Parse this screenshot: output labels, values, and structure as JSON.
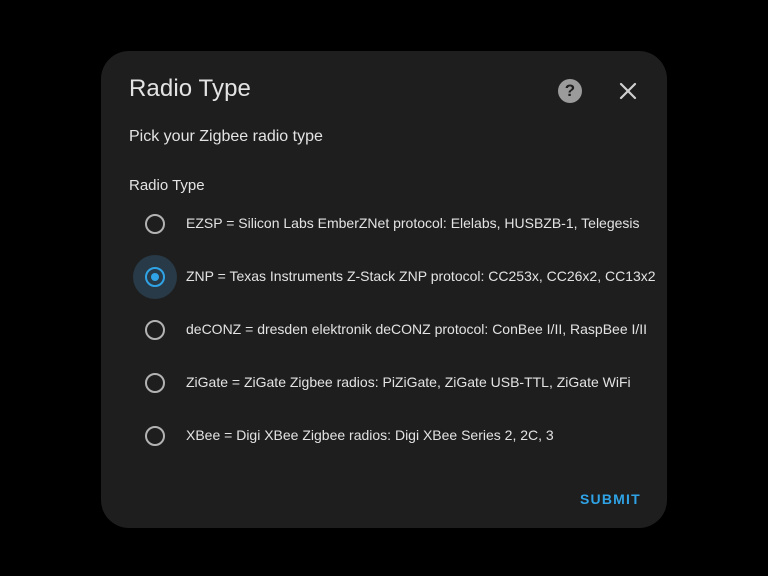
{
  "dialog": {
    "title": "Radio Type",
    "subtitle": "Pick your Zigbee radio type",
    "group_label": "Radio Type",
    "help_icon": "help-circle-icon",
    "close_icon": "close-icon",
    "submit_label": "SUBMIT",
    "selected_index": 1,
    "options": [
      {
        "label": "EZSP = Silicon Labs EmberZNet protocol: Elelabs, HUSBZB-1, Telegesis",
        "selected": false
      },
      {
        "label": "ZNP = Texas Instruments Z-Stack ZNP protocol: CC253x, CC26x2, CC13x2",
        "selected": true
      },
      {
        "label": "deCONZ = dresden elektronik deCONZ protocol: ConBee I/II, RaspBee I/II",
        "selected": false
      },
      {
        "label": "ZiGate = ZiGate Zigbee radios: PiZiGate, ZiGate USB-TTL, ZiGate WiFi",
        "selected": false
      },
      {
        "label": "XBee = Digi XBee Zigbee radios: Digi XBee Series 2, 2C, 3",
        "selected": false
      }
    ]
  },
  "colors": {
    "background": "#000000",
    "dialog_surface": "#1e1e1e",
    "text": "#e3e3e3",
    "accent": "#2fa3e6"
  }
}
